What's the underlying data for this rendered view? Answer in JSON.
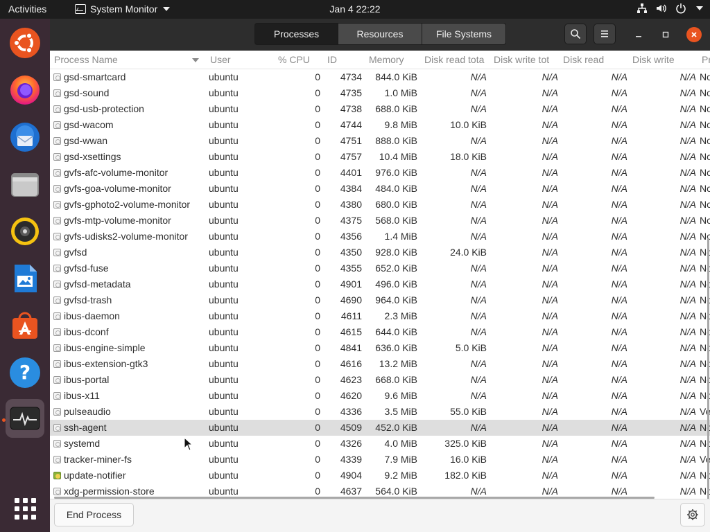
{
  "topbar": {
    "activities": "Activities",
    "app_name": "System Monitor",
    "clock": "Jan 4  22:22"
  },
  "tabs": [
    {
      "label": "Processes",
      "selected": true
    },
    {
      "label": "Resources",
      "selected": false
    },
    {
      "label": "File Systems",
      "selected": false
    }
  ],
  "columns": {
    "name": "Process Name",
    "user": "User",
    "cpu": "% CPU",
    "id": "ID",
    "memory": "Memory",
    "disk_read_total": "Disk read tota",
    "disk_write_total": "Disk write tot",
    "disk_read": "Disk read",
    "disk_write": "Disk write",
    "priority": "Pr"
  },
  "rows": [
    {
      "name": "gsd-smartcard",
      "user": "ubuntu",
      "cpu": "0",
      "id": "4734",
      "memory": "844.0 KiB",
      "read_total": "N/A",
      "write_total": "N/A",
      "read": "N/A",
      "write": "N/A",
      "priority": "No"
    },
    {
      "name": "gsd-sound",
      "user": "ubuntu",
      "cpu": "0",
      "id": "4735",
      "memory": "1.0 MiB",
      "read_total": "N/A",
      "write_total": "N/A",
      "read": "N/A",
      "write": "N/A",
      "priority": "No"
    },
    {
      "name": "gsd-usb-protection",
      "user": "ubuntu",
      "cpu": "0",
      "id": "4738",
      "memory": "688.0 KiB",
      "read_total": "N/A",
      "write_total": "N/A",
      "read": "N/A",
      "write": "N/A",
      "priority": "No"
    },
    {
      "name": "gsd-wacom",
      "user": "ubuntu",
      "cpu": "0",
      "id": "4744",
      "memory": "9.8 MiB",
      "read_total": "10.0 KiB",
      "write_total": "N/A",
      "read": "N/A",
      "write": "N/A",
      "priority": "No"
    },
    {
      "name": "gsd-wwan",
      "user": "ubuntu",
      "cpu": "0",
      "id": "4751",
      "memory": "888.0 KiB",
      "read_total": "N/A",
      "write_total": "N/A",
      "read": "N/A",
      "write": "N/A",
      "priority": "No"
    },
    {
      "name": "gsd-xsettings",
      "user": "ubuntu",
      "cpu": "0",
      "id": "4757",
      "memory": "10.4 MiB",
      "read_total": "18.0 KiB",
      "write_total": "N/A",
      "read": "N/A",
      "write": "N/A",
      "priority": "No"
    },
    {
      "name": "gvfs-afc-volume-monitor",
      "user": "ubuntu",
      "cpu": "0",
      "id": "4401",
      "memory": "976.0 KiB",
      "read_total": "N/A",
      "write_total": "N/A",
      "read": "N/A",
      "write": "N/A",
      "priority": "No"
    },
    {
      "name": "gvfs-goa-volume-monitor",
      "user": "ubuntu",
      "cpu": "0",
      "id": "4384",
      "memory": "484.0 KiB",
      "read_total": "N/A",
      "write_total": "N/A",
      "read": "N/A",
      "write": "N/A",
      "priority": "No"
    },
    {
      "name": "gvfs-gphoto2-volume-monitor",
      "user": "ubuntu",
      "cpu": "0",
      "id": "4380",
      "memory": "680.0 KiB",
      "read_total": "N/A",
      "write_total": "N/A",
      "read": "N/A",
      "write": "N/A",
      "priority": "No"
    },
    {
      "name": "gvfs-mtp-volume-monitor",
      "user": "ubuntu",
      "cpu": "0",
      "id": "4375",
      "memory": "568.0 KiB",
      "read_total": "N/A",
      "write_total": "N/A",
      "read": "N/A",
      "write": "N/A",
      "priority": "No"
    },
    {
      "name": "gvfs-udisks2-volume-monitor",
      "user": "ubuntu",
      "cpu": "0",
      "id": "4356",
      "memory": "1.4 MiB",
      "read_total": "N/A",
      "write_total": "N/A",
      "read": "N/A",
      "write": "N/A",
      "priority": "No"
    },
    {
      "name": "gvfsd",
      "user": "ubuntu",
      "cpu": "0",
      "id": "4350",
      "memory": "928.0 KiB",
      "read_total": "24.0 KiB",
      "write_total": "N/A",
      "read": "N/A",
      "write": "N/A",
      "priority": "No"
    },
    {
      "name": "gvfsd-fuse",
      "user": "ubuntu",
      "cpu": "0",
      "id": "4355",
      "memory": "652.0 KiB",
      "read_total": "N/A",
      "write_total": "N/A",
      "read": "N/A",
      "write": "N/A",
      "priority": "No"
    },
    {
      "name": "gvfsd-metadata",
      "user": "ubuntu",
      "cpu": "0",
      "id": "4901",
      "memory": "496.0 KiB",
      "read_total": "N/A",
      "write_total": "N/A",
      "read": "N/A",
      "write": "N/A",
      "priority": "No"
    },
    {
      "name": "gvfsd-trash",
      "user": "ubuntu",
      "cpu": "0",
      "id": "4690",
      "memory": "964.0 KiB",
      "read_total": "N/A",
      "write_total": "N/A",
      "read": "N/A",
      "write": "N/A",
      "priority": "No"
    },
    {
      "name": "ibus-daemon",
      "user": "ubuntu",
      "cpu": "0",
      "id": "4611",
      "memory": "2.3 MiB",
      "read_total": "N/A",
      "write_total": "N/A",
      "read": "N/A",
      "write": "N/A",
      "priority": "No"
    },
    {
      "name": "ibus-dconf",
      "user": "ubuntu",
      "cpu": "0",
      "id": "4615",
      "memory": "644.0 KiB",
      "read_total": "N/A",
      "write_total": "N/A",
      "read": "N/A",
      "write": "N/A",
      "priority": "No"
    },
    {
      "name": "ibus-engine-simple",
      "user": "ubuntu",
      "cpu": "0",
      "id": "4841",
      "memory": "636.0 KiB",
      "read_total": "5.0 KiB",
      "write_total": "N/A",
      "read": "N/A",
      "write": "N/A",
      "priority": "No"
    },
    {
      "name": "ibus-extension-gtk3",
      "user": "ubuntu",
      "cpu": "0",
      "id": "4616",
      "memory": "13.2 MiB",
      "read_total": "N/A",
      "write_total": "N/A",
      "read": "N/A",
      "write": "N/A",
      "priority": "No"
    },
    {
      "name": "ibus-portal",
      "user": "ubuntu",
      "cpu": "0",
      "id": "4623",
      "memory": "668.0 KiB",
      "read_total": "N/A",
      "write_total": "N/A",
      "read": "N/A",
      "write": "N/A",
      "priority": "No"
    },
    {
      "name": "ibus-x11",
      "user": "ubuntu",
      "cpu": "0",
      "id": "4620",
      "memory": "9.6 MiB",
      "read_total": "N/A",
      "write_total": "N/A",
      "read": "N/A",
      "write": "N/A",
      "priority": "No"
    },
    {
      "name": "pulseaudio",
      "user": "ubuntu",
      "cpu": "0",
      "id": "4336",
      "memory": "3.5 MiB",
      "read_total": "55.0 KiB",
      "write_total": "N/A",
      "read": "N/A",
      "write": "N/A",
      "priority": "Ve"
    },
    {
      "name": "ssh-agent",
      "user": "ubuntu",
      "cpu": "0",
      "id": "4509",
      "memory": "452.0 KiB",
      "read_total": "N/A",
      "write_total": "N/A",
      "read": "N/A",
      "write": "N/A",
      "priority": "No",
      "selected": true
    },
    {
      "name": "systemd",
      "user": "ubuntu",
      "cpu": "0",
      "id": "4326",
      "memory": "4.0 MiB",
      "read_total": "325.0 KiB",
      "write_total": "N/A",
      "read": "N/A",
      "write": "N/A",
      "priority": "No"
    },
    {
      "name": "tracker-miner-fs",
      "user": "ubuntu",
      "cpu": "0",
      "id": "4339",
      "memory": "7.9 MiB",
      "read_total": "16.0 KiB",
      "write_total": "N/A",
      "read": "N/A",
      "write": "N/A",
      "priority": "Ve"
    },
    {
      "name": "update-notifier",
      "user": "ubuntu",
      "cpu": "0",
      "id": "4904",
      "memory": "9.2 MiB",
      "read_total": "182.0 KiB",
      "write_total": "N/A",
      "read": "N/A",
      "write": "N/A",
      "priority": "No",
      "icon": "notifier"
    },
    {
      "name": "xdg-permission-store",
      "user": "ubuntu",
      "cpu": "0",
      "id": "4637",
      "memory": "564.0 KiB",
      "read_total": "N/A",
      "write_total": "N/A",
      "read": "N/A",
      "write": "N/A",
      "priority": "No"
    }
  ],
  "footer": {
    "end_process": "End Process"
  },
  "dock": [
    {
      "name": "ubuntu-logo-icon"
    },
    {
      "name": "firefox-icon"
    },
    {
      "name": "thunderbird-icon"
    },
    {
      "name": "files-icon"
    },
    {
      "name": "rhythmbox-icon"
    },
    {
      "name": "libreoffice-writer-icon"
    },
    {
      "name": "software-store-icon"
    },
    {
      "name": "help-icon"
    },
    {
      "name": "system-monitor-icon",
      "active": true
    },
    {
      "name": "show-apps-icon"
    }
  ],
  "colors": {
    "accent": "#e95420",
    "selection": "#dedede",
    "dock_bg": "#3a2a34",
    "headerbar": "#2d2d2d"
  }
}
